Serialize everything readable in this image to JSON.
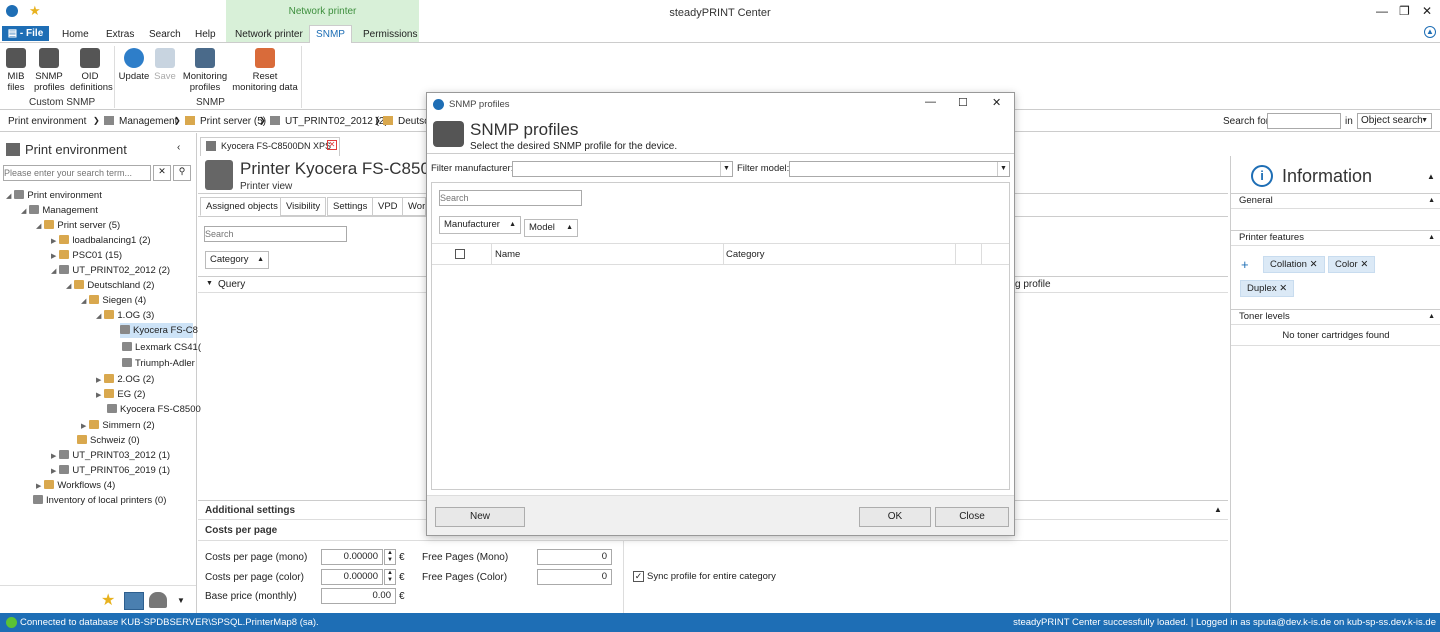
{
  "app": {
    "title": "steadyPRINT Center",
    "context_group": "Network printer"
  },
  "tabs": [
    "Home",
    "Extras",
    "Search",
    "Help",
    "Network printer",
    "SNMP",
    "Permissions"
  ],
  "file_tab": "File",
  "ribbon": {
    "mib": "MIB files",
    "snmp_profiles": "SNMP profiles",
    "oid": "OID definitions",
    "update": "Update",
    "save": "Save",
    "monitoring": "Monitoring profiles",
    "reset": "Reset monitoring data",
    "group_custom": "Custom SNMP",
    "group_snmp": "SNMP"
  },
  "breadcrumb": [
    "Print environment",
    "Management",
    "Print server (5)",
    "UT_PRINT02_2012 (2)",
    "Deutsc"
  ],
  "search": {
    "label": "Search for",
    "in_label": "in",
    "scope": "Object search"
  },
  "left": {
    "title": "Print environment",
    "search_placeholder": "Please enter your search term...",
    "tree": [
      "Print environment",
      "Management",
      "Print server (5)",
      "loadbalancing1 (2)",
      "PSC01 (15)",
      "UT_PRINT02_2012 (2)",
      "Deutschland (2)",
      "Siegen (4)",
      "1.OG (3)",
      "Kyocera FS-C8",
      "Lexmark CS41(",
      "Triumph-Adler",
      "2.OG (2)",
      "EG (2)",
      "Kyocera FS-C8500",
      "Simmern (2)",
      "Schweiz (0)",
      "UT_PRINT03_2012 (1)",
      "UT_PRINT06_2019 (1)",
      "Workflows (4)",
      "Inventory of local printers (0)"
    ]
  },
  "doc": {
    "tab": "Kyocera FS-C8500DN XPS",
    "title": "Printer Kyocera FS-C850",
    "subtitle": "Printer view",
    "subtabs": [
      "Assigned objects",
      "Visibility",
      "Settings",
      "VPD",
      "Wor"
    ],
    "search_placeholder": "Search",
    "group_by": "Category",
    "query_col": "Query",
    "profile_col": "g profile",
    "additional": "Additional settings",
    "costs": "Costs per page",
    "costs_mono_label": "Costs per page (mono)",
    "costs_mono": "0.00000",
    "costs_color_label": "Costs per page (color)",
    "costs_color": "0.00000",
    "base_label": "Base price (monthly)",
    "base": "0.00",
    "currency": "€",
    "free_mono_label": "Free Pages (Mono)",
    "free_mono": "0",
    "free_color_label": "Free Pages (Color)",
    "free_color": "0",
    "sync_label": "Sync profile for entire category"
  },
  "info": {
    "title": "Information",
    "general": "General",
    "features": "Printer features",
    "chips": [
      "Collation",
      "Color",
      "Duplex"
    ],
    "toner": "Toner levels",
    "toner_empty": "No toner cartridges found"
  },
  "dialog": {
    "window_title": "SNMP profiles",
    "heading": "SNMP profiles",
    "subheading": "Select the desired SNMP profile for the device.",
    "filter_manufacturer": "Filter manufacturer:",
    "filter_model": "Filter model:",
    "search_placeholder": "Search",
    "group1": "Manufacturer",
    "group2": "Model",
    "col_name": "Name",
    "col_category": "Category",
    "new": "New",
    "ok": "OK",
    "close": "Close"
  },
  "status": {
    "left": "Connected to database KUB-SPDBSERVER\\SPSQL.PrinterMap8 (sa).",
    "right": "steadyPRINT Center successfully loaded. | Logged in as sputa@dev.k-is.de on kub-sp-ss.dev.k-is.de"
  },
  "colors": {
    "accent": "#1e6eb5",
    "context": "#d8f0d8"
  }
}
